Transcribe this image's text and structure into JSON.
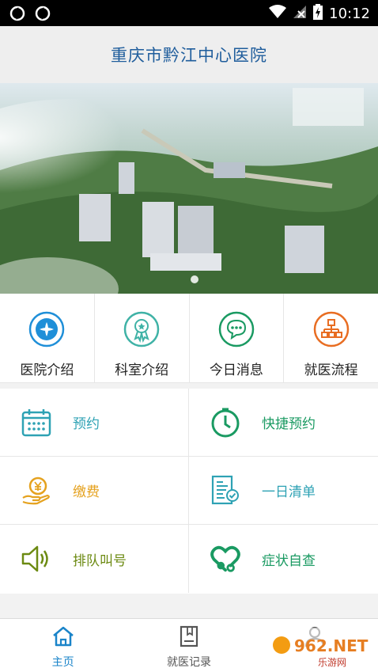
{
  "status_bar": {
    "time": "10:12"
  },
  "header": {
    "title": "重庆市黔江中心医院"
  },
  "quick_nav": [
    {
      "label": "医院介绍",
      "icon": "hospital-cross-icon",
      "color": "#1f8fd8"
    },
    {
      "label": "科室介绍",
      "icon": "ribbon-badge-icon",
      "color": "#3fb2a6"
    },
    {
      "label": "今日消息",
      "icon": "chat-bubble-icon",
      "color": "#1a9a62"
    },
    {
      "label": "就医流程",
      "icon": "flowchart-icon",
      "color": "#e86d22"
    }
  ],
  "services": [
    {
      "label": "预约",
      "icon": "calendar-icon",
      "color": "#2ea2b4"
    },
    {
      "label": "快捷预约",
      "icon": "clock-icon",
      "color": "#1a9a62"
    },
    {
      "label": "缴费",
      "icon": "yen-coin-hand-icon",
      "color": "#e5a21f"
    },
    {
      "label": "一日清单",
      "icon": "checklist-icon",
      "color": "#2ea2b4"
    },
    {
      "label": "排队叫号",
      "icon": "speaker-icon",
      "color": "#6c8a12"
    },
    {
      "label": "症状自查",
      "icon": "heart-stethoscope-icon",
      "color": "#1a9a62"
    }
  ],
  "tabs": [
    {
      "label": "主页",
      "icon": "home-icon",
      "active": true
    },
    {
      "label": "就医记录",
      "icon": "record-book-icon",
      "active": false
    },
    {
      "label": "",
      "icon": "user-icon",
      "active": false
    }
  ],
  "watermark": {
    "brand": "962.NET",
    "sub": "乐游网"
  },
  "colors": {
    "title": "#1f5d9c",
    "active_tab": "#1a84c9"
  }
}
